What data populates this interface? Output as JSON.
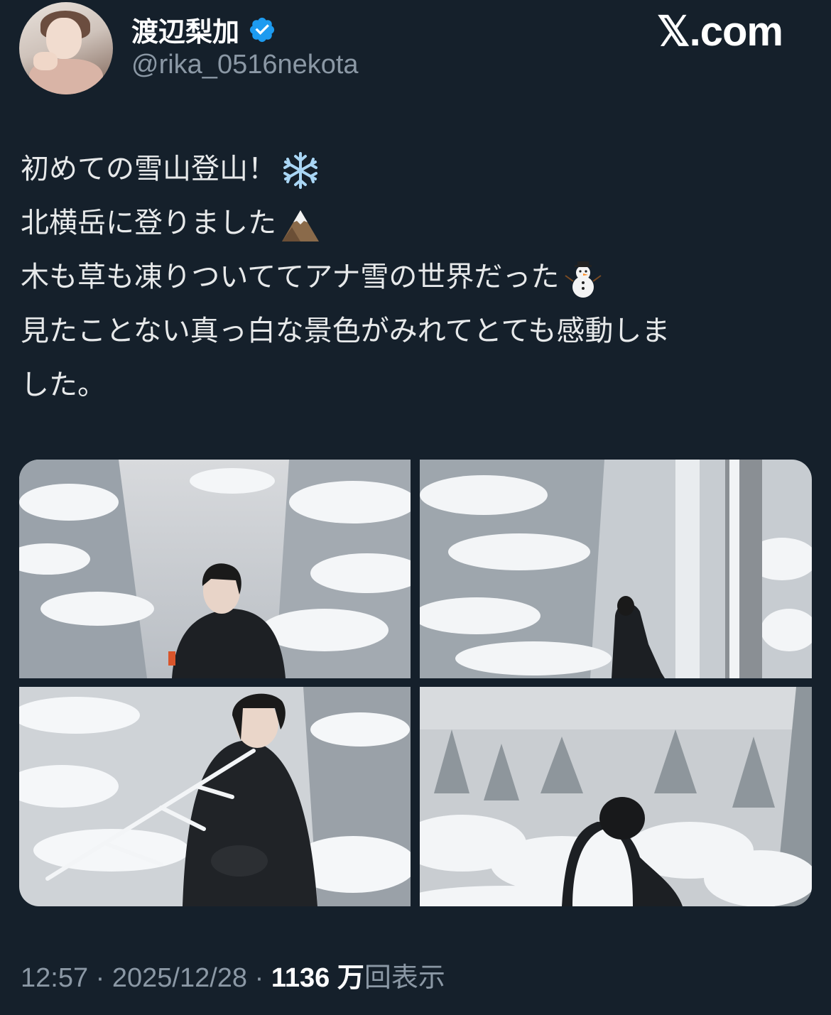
{
  "author": {
    "display_name": "渡辺梨加",
    "handle": "@rika_0516nekota",
    "verified_icon": "verified-badge-icon",
    "verified_color": "#1d9bf0"
  },
  "site_logo": "𝕏.com",
  "tweet": {
    "lines": [
      "初めての雪山登山！",
      "北横岳に登りました",
      "木も草も凍りついててアナ雪の世界だった",
      "見たことない真っ白な景色がみれてとても感動しま",
      "した。"
    ],
    "emojis": [
      "snowflake-icon",
      "mountain-icon",
      "snowman-icon"
    ]
  },
  "photos": [
    {
      "name": "photo-1"
    },
    {
      "name": "photo-2"
    },
    {
      "name": "photo-3"
    },
    {
      "name": "photo-4"
    }
  ],
  "meta": {
    "time": "12:57",
    "sep1": " · ",
    "date": "2025/12/28",
    "sep2": " · ",
    "views_count": "1136 万",
    "views_label": "回表示"
  },
  "colors": {
    "background": "#15202b",
    "secondary_text": "#8b98a5",
    "primary_text": "#e7e9ea"
  }
}
